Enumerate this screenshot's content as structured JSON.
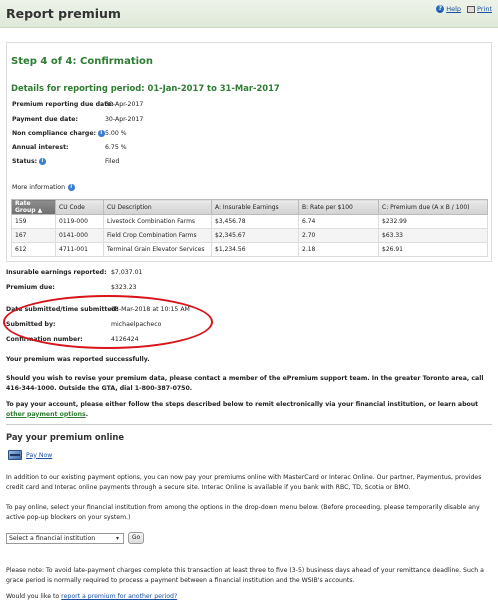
{
  "header": {
    "title": "Report premium",
    "help": "Help",
    "print": "Print"
  },
  "step": "Step 4 of 4: Confirmation",
  "details_title": "Details for reporting period: 01-Jan-2017 to 31-Mar-2017",
  "fields": [
    {
      "label": "Premium reporting due date:",
      "value": "30-Apr-2017",
      "info": false
    },
    {
      "label": "Payment due date:",
      "value": "30-Apr-2017",
      "info": false
    },
    {
      "label": "Non compliance charge:",
      "value": "5.00 %",
      "info": true
    },
    {
      "label": "Annual interest:",
      "value": "6.75 %",
      "info": false
    },
    {
      "label": "Status:",
      "value": "Filed",
      "info": true
    }
  ],
  "more_info": "More information",
  "table": {
    "headers": [
      "Rate Group",
      "CU Code",
      "CU Description",
      "A: Insurable Earnings",
      "B: Rate per $100",
      "C: Premium due (A x B / 100)"
    ],
    "rows": [
      [
        "159",
        "0119-000",
        "Livestock Combination Farms",
        "$3,456.78",
        "6.74",
        "$232.99"
      ],
      [
        "167",
        "0141-000",
        "Field Crop Combination Farms",
        "$2,345.67",
        "2.70",
        "$63.33"
      ],
      [
        "612",
        "4711-001",
        "Terminal Grain Elevator Services",
        "$1,234.56",
        "2.18",
        "$26.91"
      ]
    ]
  },
  "summary": [
    {
      "label": "Insurable earnings reported:",
      "value": "$7,037.01"
    },
    {
      "label": "Premium due:",
      "value": "$323.23"
    }
  ],
  "submission": [
    {
      "label": "Date submitted/time submitted:",
      "value": "08-Mar-2018 at 10:15 AM"
    },
    {
      "label": "Submitted by:",
      "value": "michaelpacheco"
    },
    {
      "label": "Confirmation number:",
      "value": "4126424"
    }
  ],
  "success": "Your premium was reported successfully.",
  "revise": "Should you wish to revise your premium data, please contact a member of the ePremium support team. In the greater Toronto area, call 416-344-1000. Outside the GTA, dial 1-800-387-0750.",
  "pay_account": {
    "text": "To pay your account, please either follow the steps described below to remit electronically via your financial institution, or learn about",
    "link": "other payment options",
    "end": "."
  },
  "pay_online": {
    "heading": "Pay your premium online",
    "pay_now": "Pay Now",
    "p1": "In addition to our existing payment options, you can now pay your premiums online with MasterCard or Interac Online. Our partner, Paymentus, provides credit card and Interac online payments through a secure site. Interac Online is available if you bank with RBC, TD, Scotia or BMO.",
    "p2": "To pay online, select your financial institution from among the options in the drop-down menu below. (Before proceeding, please temporarily disable any active pop-up blockers on your system.)",
    "select_value": "Select a financial institution",
    "go": "Go",
    "note": "Please note: To avoid late-payment charges complete this transaction at least three to five (3-5) business days ahead of your remittance deadline. Such a grace period is normally required to process a payment between a financial institution and the WSIB's accounts.",
    "another_text": "Would you like to",
    "another_link": "report a premium for another period?"
  }
}
